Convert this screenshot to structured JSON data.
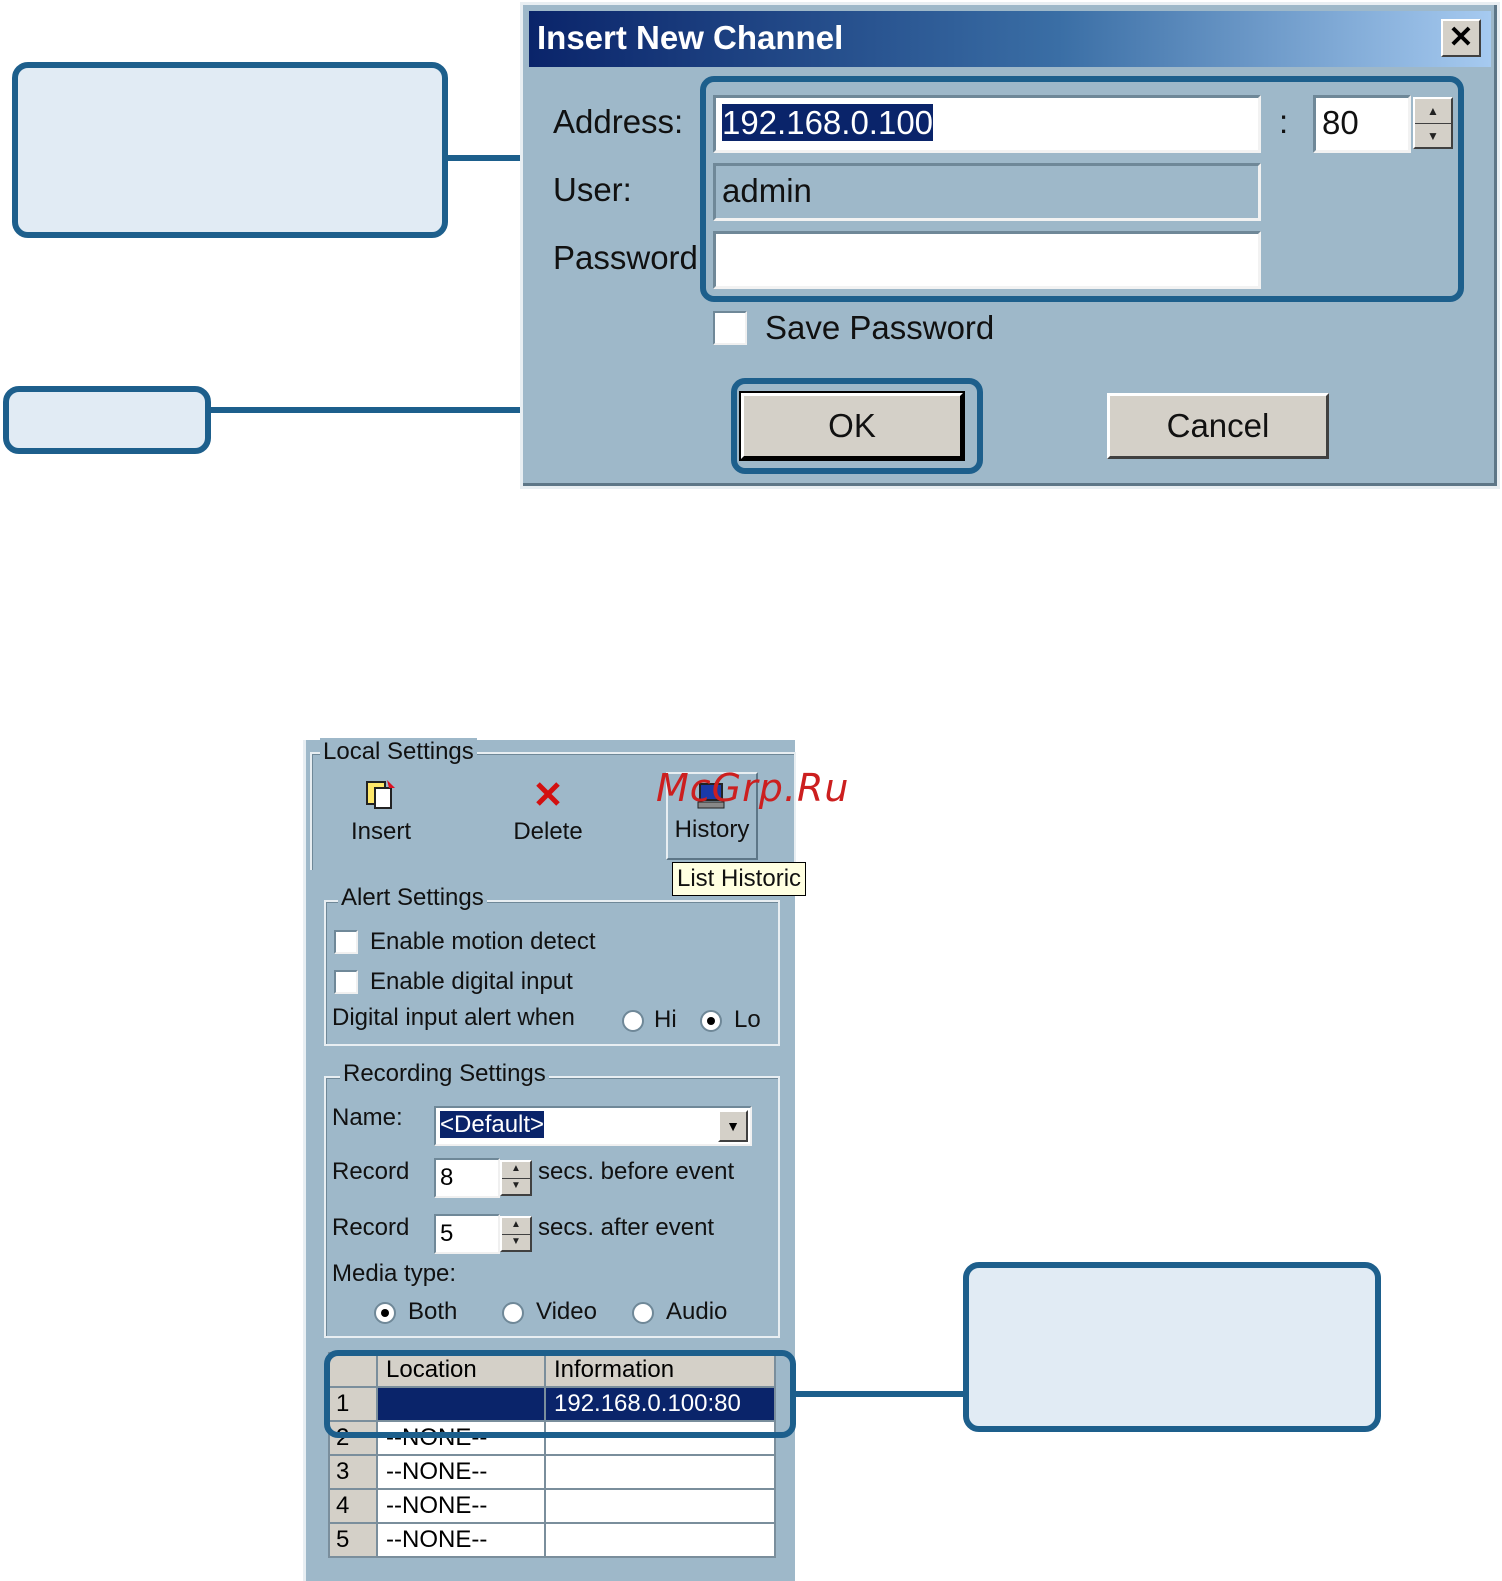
{
  "dialog": {
    "title": "Insert New Channel",
    "close_glyph": "✕",
    "address_label": "Address:",
    "address_value": "192.168.0.100",
    "port_separator": ":",
    "port_value": "80",
    "user_label": "User:",
    "user_value": "admin",
    "password_label": "Password:",
    "password_value": "",
    "save_password_label": "Save Password",
    "ok_label": "OK",
    "cancel_label": "Cancel"
  },
  "panel": {
    "local_settings_title": "Local Settings",
    "toolbar": {
      "insert_label": "Insert",
      "delete_label": "Delete",
      "history_label": "History",
      "tooltip": "List Historic"
    },
    "alert": {
      "title": "Alert Settings",
      "motion_label": "Enable motion detect",
      "digital_label": "Enable digital input",
      "alert_when_label": "Digital input alert when",
      "hi_label": "Hi",
      "lo_label": "Lo",
      "selected": "Lo"
    },
    "recording": {
      "title": "Recording Settings",
      "name_label": "Name:",
      "name_value": "<Default>",
      "record_label_1": "Record",
      "before_value": "8",
      "before_suffix": "secs. before event",
      "record_label_2": "Record",
      "after_value": "5",
      "after_suffix": "secs. after event",
      "media_label": "Media type:",
      "both_label": "Both",
      "video_label": "Video",
      "audio_label": "Audio",
      "media_selected": "Both"
    },
    "table": {
      "columns": [
        "Location",
        "Information"
      ],
      "rows": [
        {
          "num": "1",
          "location": "",
          "information": "192.168.0.100:80"
        },
        {
          "num": "2",
          "location": "--NONE--",
          "information": ""
        },
        {
          "num": "3",
          "location": "--NONE--",
          "information": ""
        },
        {
          "num": "4",
          "location": "--NONE--",
          "information": ""
        },
        {
          "num": "5",
          "location": "--NONE--",
          "information": ""
        }
      ]
    }
  },
  "watermark": "McGrp.Ru",
  "colors": {
    "callout_border": "#1d5f8c",
    "callout_fill": "#e1ebf4",
    "dialog_bg": "#9eb8c9",
    "selection": "#0a246a",
    "watermark": "#cc1f1f"
  }
}
